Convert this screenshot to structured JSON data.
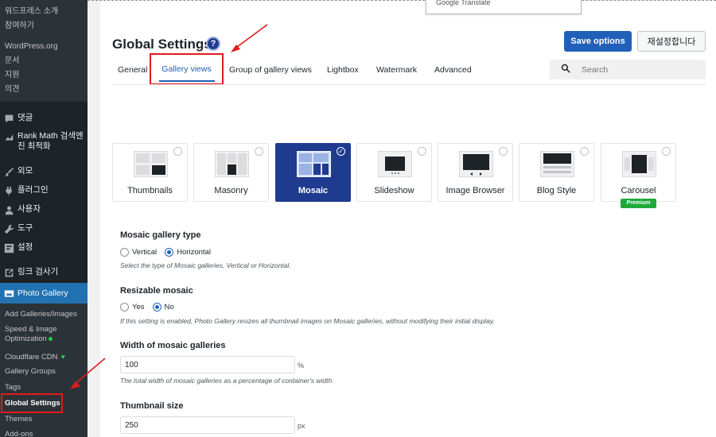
{
  "sidebar": {
    "wp_menu": [
      "워드프레스 소개",
      "참여하기",
      "WordPress.org",
      "문서",
      "지원",
      "의견"
    ],
    "items": [
      {
        "label": "댓글",
        "icon": "comment-icon"
      },
      {
        "label": "Rank Math 검색엔진 최적화",
        "icon": "rank-math-icon"
      },
      {
        "label": "외모",
        "icon": "brush-icon"
      },
      {
        "label": "플러그인",
        "icon": "plugin-icon"
      },
      {
        "label": "사용자",
        "icon": "user-icon"
      },
      {
        "label": "도구",
        "icon": "wrench-icon"
      },
      {
        "label": "설정",
        "icon": "settings-icon"
      },
      {
        "label": "링크 검사기",
        "icon": "link-icon"
      }
    ],
    "photo_gallery": "Photo Gallery",
    "submenu": [
      "Add Galleries/Images",
      "Speed & Image Optimization",
      "Cloudflare CDN",
      "Gallery Groups",
      "Tags",
      "Global Settings",
      "Themes",
      "Add-ons"
    ]
  },
  "topbar": {
    "google_translate": "Google Translate"
  },
  "header": {
    "title": "Global Settings",
    "help": "?",
    "save": "Save options",
    "reset": "재설정합니다"
  },
  "tabs": [
    "General",
    "Gallery views",
    "Group of gallery views",
    "Lightbox",
    "Watermark",
    "Advanced"
  ],
  "search": {
    "placeholder": "Search"
  },
  "views": [
    {
      "label": "Thumbnails",
      "selected": false
    },
    {
      "label": "Masonry",
      "selected": false
    },
    {
      "label": "Mosaic",
      "selected": true
    },
    {
      "label": "Slideshow",
      "selected": false
    },
    {
      "label": "Image Browser",
      "selected": false
    },
    {
      "label": "Blog Style",
      "selected": false
    },
    {
      "label": "Carousel",
      "selected": false,
      "badge": "Premium"
    }
  ],
  "settings": {
    "mosaic_type": {
      "title": "Mosaic gallery type",
      "options": [
        "Vertical",
        "Horizontal"
      ],
      "selected": "Horizontal",
      "desc": "Select the type of Mosaic galleries, Vertical or Horizontal."
    },
    "resizable": {
      "title": "Resizable mosaic",
      "options": [
        "Yes",
        "No"
      ],
      "selected": "No",
      "desc": "If this setting is enabled, Photo Gallery resizes all thumbnail images on Mosaic galleries, without modifying their initial display."
    },
    "width": {
      "title": "Width of mosaic galleries",
      "value": "100",
      "unit": "%",
      "desc": "The total width of mosaic galleries as a percentage of container's width."
    },
    "thumb_size": {
      "title": "Thumbnail size",
      "value": "250",
      "unit": "px"
    }
  },
  "colors": {
    "accent": "#2160b8",
    "selected_card": "#1f3b8f",
    "sidebar": "#1d2327",
    "highlight": "#e11b1b",
    "premium": "#1ea93a"
  }
}
